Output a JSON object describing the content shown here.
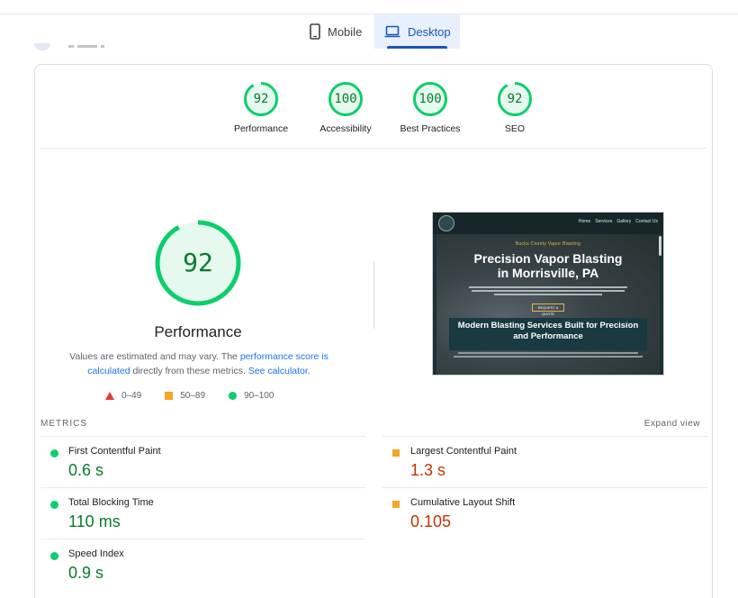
{
  "device_tabs": [
    {
      "label": "Mobile",
      "icon": "mobile-phone-icon",
      "active": false
    },
    {
      "label": "Desktop",
      "icon": "laptop-icon",
      "active": true
    }
  ],
  "categories": [
    {
      "score": "92",
      "label": "Performance",
      "fraction": 0.92
    },
    {
      "score": "100",
      "label": "Accessibility",
      "fraction": 1.0
    },
    {
      "score": "100",
      "label": "Best Practices",
      "fraction": 1.0
    },
    {
      "score": "92",
      "label": "SEO",
      "fraction": 0.92
    }
  ],
  "performance": {
    "score": "92",
    "fraction": 0.92,
    "title": "Performance",
    "desc_prefix": "Values are estimated and may vary. The ",
    "desc_link1": "performance score is calculated",
    "desc_middle": " directly from these metrics. ",
    "desc_link2": "See calculator",
    "desc_suffix": "."
  },
  "legend": {
    "fail": "0–49",
    "average": "50–89",
    "pass": "90–100"
  },
  "screenshot": {
    "nav_items": [
      "Home",
      "Services",
      "Gallery",
      "Contact Us"
    ],
    "kicker": "Bucks County Vapor Blasting",
    "heading_line1": "Precision Vapor Blasting",
    "heading_line2": "in Morrisville, PA",
    "button": "REQUEST A QUOTE",
    "subheading_line1": "Modern Blasting Services Built for Precision",
    "subheading_line2": "and Performance"
  },
  "metrics": {
    "heading": "METRICS",
    "expand_label": "Expand view",
    "items": [
      {
        "name": "First Contentful Paint",
        "value": "0.6 s",
        "rating": "pass"
      },
      {
        "name": "Largest Contentful Paint",
        "value": "1.3 s",
        "rating": "average"
      },
      {
        "name": "Total Blocking Time",
        "value": "110 ms",
        "rating": "pass"
      },
      {
        "name": "Cumulative Layout Shift",
        "value": "0.105",
        "rating": "average"
      },
      {
        "name": "Speed Index",
        "value": "0.9 s",
        "rating": "pass"
      }
    ]
  },
  "colors": {
    "pass": "#0cce6b",
    "pass_text": "#0a7a2d",
    "average": "#f5a623",
    "average_text": "#c33300",
    "fail": "#e5383b",
    "link": "#1a73e8",
    "active_tab": "#1a56bd"
  }
}
